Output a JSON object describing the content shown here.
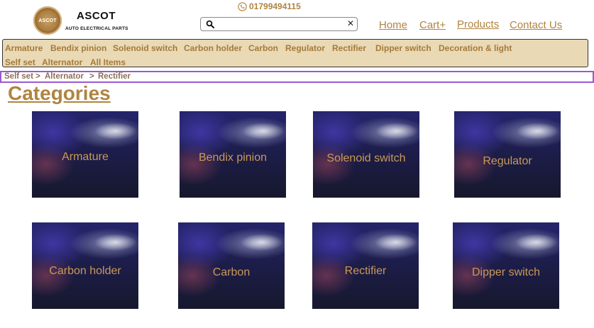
{
  "brand": {
    "logo_text": "ASCOT",
    "name": "ASCOT",
    "subtitle": "AUTO ELECTRICAL PARTS"
  },
  "header": {
    "phone": "01799494115",
    "search": {
      "placeholder": "",
      "value": "",
      "clear_symbol": "✕"
    },
    "nav": [
      "Home",
      "Cart+",
      "Products",
      "Contact Us"
    ]
  },
  "category_bar": [
    "Armature",
    "Bendix pinion",
    "Solenoid switch",
    "Carbon holder",
    "Carbon",
    "Regulator",
    "Rectifier",
    "Dipper switch",
    "Decoration & light",
    "Self set",
    "Alternator",
    "All Items"
  ],
  "breadcrumb": [
    "Self set >",
    "Alternator",
    ">",
    "Rectifier"
  ],
  "page": {
    "heading": "Categories"
  },
  "cards": [
    "Armature",
    "Bendix pinion",
    "Solenoid switch",
    "Regulator",
    "Carbon holder",
    "Carbon",
    "Rectifier",
    "Dipper switch"
  ],
  "colors": {
    "accent": "#b08440",
    "bar_bg": "#e9d9b5",
    "breadcrumb_border": "#9b59d0"
  }
}
